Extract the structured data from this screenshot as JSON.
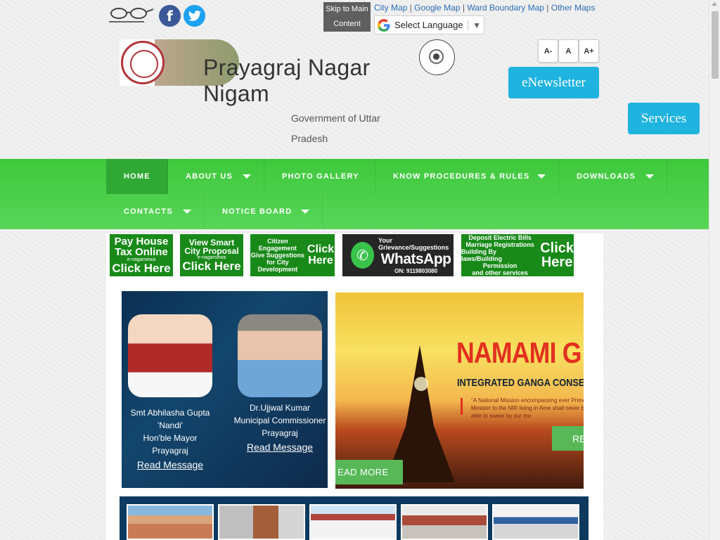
{
  "top": {
    "skip": [
      "Skip to Main",
      "Content"
    ],
    "links": [
      "City Map",
      "Google Map",
      "Ward Boundary Map",
      "Other Maps"
    ],
    "separator": "|",
    "language": "Select Language",
    "language_caret": "▼",
    "social": {
      "facebook": "f",
      "twitter": "t"
    }
  },
  "header": {
    "title_line1": "Prayagraj Nagar",
    "title_line2": "Nigam",
    "subtitle_line1": "Government of Uttar",
    "subtitle_line2": "Pradesh",
    "font_buttons": [
      "A-",
      "A",
      "A+"
    ],
    "enewsletter": "eNewsletter",
    "services": "Services"
  },
  "nav": {
    "items": [
      {
        "label": "HOME",
        "dropdown": false,
        "active": true
      },
      {
        "label": "ABOUT US",
        "dropdown": true
      },
      {
        "label": "PHOTO GALLERY",
        "dropdown": false
      },
      {
        "label": "KNOW PROCEDURES & RULES",
        "dropdown": true
      },
      {
        "label": "DOWNLOADS",
        "dropdown": true
      },
      {
        "label": "CONTACTS",
        "dropdown": true
      },
      {
        "label": "NOTICE BOARD",
        "dropdown": true
      }
    ]
  },
  "banners": {
    "house_tax": {
      "l1": "Pay House",
      "l2": "Tax Online",
      "l3": "e-nagarsewa",
      "l4": "Click Here"
    },
    "smart_city": {
      "l1": "View Smart",
      "l2": "City Proposal",
      "l3": "e-nagarsewa",
      "l4": "Click Here"
    },
    "citizen": {
      "l1": "Citizen",
      "l2": "Engagement",
      "l3": "Give Suggestions",
      "l4": "for City",
      "l5": "Development",
      "click": "Click",
      "here": "Here"
    },
    "whatsapp": {
      "l1": "Your Grievance/Suggestions",
      "l2": "WhatsApp",
      "l3": "ON: 9119803080"
    },
    "electric": {
      "l1": "Deposit Electric Bills",
      "l2": "Marriage Registrations",
      "l3": "Building By laws/Building",
      "l4": "Permission",
      "l5": "and other services",
      "click": "Click",
      "here": "Here"
    }
  },
  "officials": [
    {
      "name": "Smt Abhilasha Gupta 'Nandi'",
      "role": "Hon'ble Mayor",
      "place": "Prayagraj",
      "link": "Read Message"
    },
    {
      "name": "Dr.Ujjwal Kumar",
      "role": "Municipal Commissioner",
      "place": "Prayagraj",
      "link": "Read Message"
    }
  ],
  "slider": {
    "title": "NAMAMI G",
    "subtitle": "INTEGRATED GANGA CONSERV",
    "desc": "\"A National Mission encompassing ever Prime Minister to the NRI living in Ame shall never be able to swear by our mo",
    "read_right": "RE",
    "read_more": "EAD MORE"
  },
  "colors": {
    "nav_green": "#3fc83c",
    "active_green": "#2fa834",
    "button_blue": "#1fb3df",
    "banner_green": "#198a19",
    "panel_navy": "#0d3a5e",
    "link_blue": "#2d6db5"
  }
}
